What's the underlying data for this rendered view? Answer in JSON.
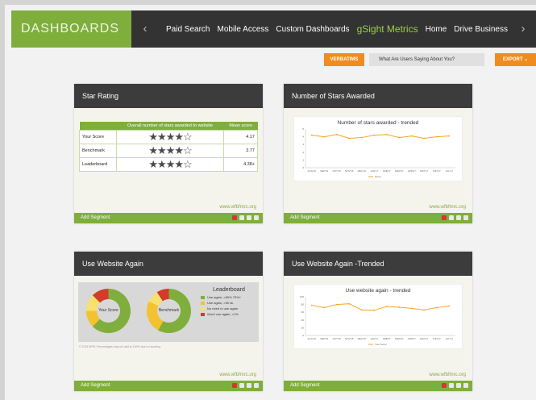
{
  "header": {
    "brand": "DASHBOARDS",
    "prev_icon": "‹",
    "next_icon": "›",
    "nav": [
      "Paid Search",
      "Mobile Access",
      "Custom Dashboards",
      "gSight Metrics",
      "Home",
      "Drive Business"
    ],
    "active_nav": "gSight Metrics"
  },
  "controls": {
    "verbatims": "VERBATIMS",
    "question": "What Are Users Saying About You?",
    "export": "EXPORT"
  },
  "colors": {
    "brand_green": "#7fae3c",
    "orange": "#f08c1e",
    "dark": "#3c3c3c"
  },
  "widgets": {
    "star_rating": {
      "title": "Star Rating",
      "table_header": [
        "",
        "Overall number of stars awarded to website",
        "Mean score"
      ],
      "rows": [
        {
          "label": "Your Score",
          "stars": "★★★★☆",
          "value": "4.17"
        },
        {
          "label": "Benchmark",
          "stars": "★★★★☆",
          "value": "3.77"
        },
        {
          "label": "Leaderboard",
          "stars": "★★★★☆",
          "value": "4.38+"
        }
      ],
      "site": "www.wfbfmrc.org",
      "footer": "Add Segment"
    },
    "stars_awarded": {
      "title": "Number of Stars Awarded",
      "site": "www.wfbfmrc.org",
      "footer": "Add Segment"
    },
    "use_again": {
      "title": "Use Website Again",
      "donut1_label": "Your Score",
      "donut2_label": "Benchmark",
      "legend_title": "Leaderboard",
      "legend_items": [
        {
          "label": "Use again, >60% 70%+",
          "color": "#7fae3c"
        },
        {
          "label": "Use again, >50 ok",
          "color": "#f2c230"
        },
        {
          "label": "No need to use again",
          "color": "#f5e070"
        },
        {
          "label": "Won't use again, <1%",
          "color": "#d43b2a"
        }
      ],
      "note": "© 2015 WFB. Percentages may not add to 100% due to rounding",
      "site": "www.wfbfmrc.org",
      "footer": "Add Segment"
    },
    "use_again_trended": {
      "title": "Use Website Again -Trended",
      "site": "www.wfbfmrc.org",
      "footer": "Add Segment"
    }
  },
  "chart_data": [
    {
      "type": "line",
      "title": "Number of stars awarded - trended",
      "x": [
        "AUG'16",
        "SEP'16",
        "OCT'16",
        "NOV'16",
        "DEC'16",
        "JAN'17",
        "FEB'17",
        "MAR'17",
        "APR'17",
        "MAY'17",
        "JUN'17",
        "JUL'17"
      ],
      "series": [
        {
          "name": "Score",
          "values": [
            4.2,
            4.0,
            4.3,
            3.8,
            3.9,
            4.2,
            4.3,
            3.9,
            4.1,
            3.8,
            4.0,
            4.1
          ]
        }
      ],
      "yticks": [
        "0",
        "1",
        "2",
        "3",
        "4",
        "5"
      ],
      "ylim": [
        0,
        5
      ],
      "grid": false,
      "legend": "bottom",
      "color": "#f5a623"
    },
    {
      "type": "line",
      "title": "Use website again - trended",
      "x": [
        "AUG'16",
        "SEP'16",
        "OCT'16",
        "NOV'16",
        "DEC'16",
        "JAN'17",
        "FEB'17",
        "MAR'17",
        "APR'17",
        "MAY'17",
        "JUN'17",
        "JUL'17"
      ],
      "series": [
        {
          "name": "Your Score",
          "values": [
            78,
            72,
            80,
            82,
            66,
            65,
            75,
            73,
            70,
            66,
            72,
            76
          ]
        }
      ],
      "yticks": [
        "0",
        "20",
        "40",
        "60",
        "80",
        "100"
      ],
      "ylim": [
        0,
        100
      ],
      "grid": false,
      "legend": "bottom",
      "color": "#f5a623"
    },
    {
      "type": "pie",
      "title": "Your Score",
      "categories": [
        "Use again",
        "Use again ok",
        "No need",
        "Won't use again"
      ],
      "values": [
        62.5,
        12.5,
        12.5,
        12.5
      ],
      "colors": [
        "#7fae3c",
        "#f2c230",
        "#f5e070",
        "#d43b2a"
      ]
    },
    {
      "type": "pie",
      "title": "Benchmark",
      "categories": [
        "Use again",
        "Use again ok",
        "No need",
        "Won't use again"
      ],
      "values": [
        58,
        24,
        9,
        9
      ],
      "colors": [
        "#7fae3c",
        "#f2c230",
        "#f5e070",
        "#d43b2a"
      ]
    }
  ]
}
